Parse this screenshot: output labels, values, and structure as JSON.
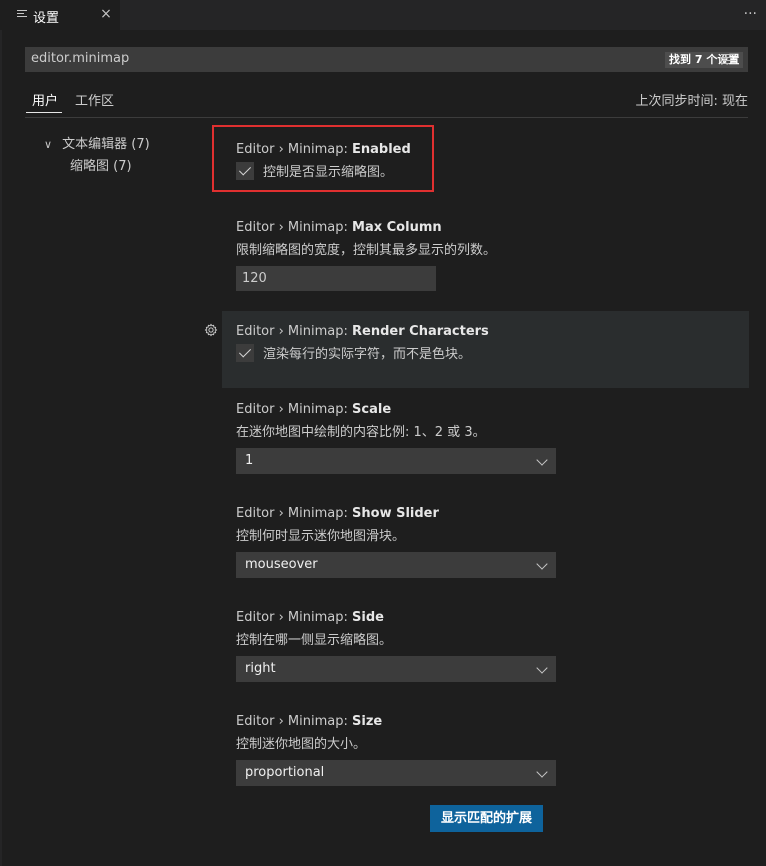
{
  "tab": {
    "title": "设置",
    "close": "×"
  },
  "more_actions": "···",
  "search": {
    "value": "editor.minimap",
    "count": "找到 7 个设置"
  },
  "scopes": {
    "user": "用户",
    "workspace": "工作区"
  },
  "sync_status": "上次同步时间: 现在",
  "toc": {
    "group": "文本编辑器 (7)",
    "item": "缩略图 (7)"
  },
  "settings": {
    "enabled": {
      "prefix": "Editor › Minimap: ",
      "name": "Enabled",
      "desc": "控制是否显示缩略图。",
      "checked": true
    },
    "max_column": {
      "prefix": "Editor › Minimap: ",
      "name": "Max Column",
      "desc": "限制缩略图的宽度，控制其最多显示的列数。",
      "value": "120"
    },
    "render_characters": {
      "prefix": "Editor › Minimap: ",
      "name": "Render Characters",
      "desc": "渲染每行的实际字符，而不是色块。",
      "checked": true
    },
    "scale": {
      "prefix": "Editor › Minimap: ",
      "name": "Scale",
      "desc": "在迷你地图中绘制的内容比例: 1、2 或 3。",
      "value": "1"
    },
    "show_slider": {
      "prefix": "Editor › Minimap: ",
      "name": "Show Slider",
      "desc": "控制何时显示迷你地图滑块。",
      "value": "mouseover"
    },
    "side": {
      "prefix": "Editor › Minimap: ",
      "name": "Side",
      "desc": "控制在哪一侧显示缩略图。",
      "value": "right"
    },
    "size": {
      "prefix": "Editor › Minimap: ",
      "name": "Size",
      "desc": "控制迷你地图的大小。",
      "value": "proportional"
    }
  },
  "show_extensions_button": "显示匹配的扩展",
  "colors": {
    "accent": "#0e639c",
    "highlight": "#e03030",
    "background": "#1e1e1e"
  }
}
